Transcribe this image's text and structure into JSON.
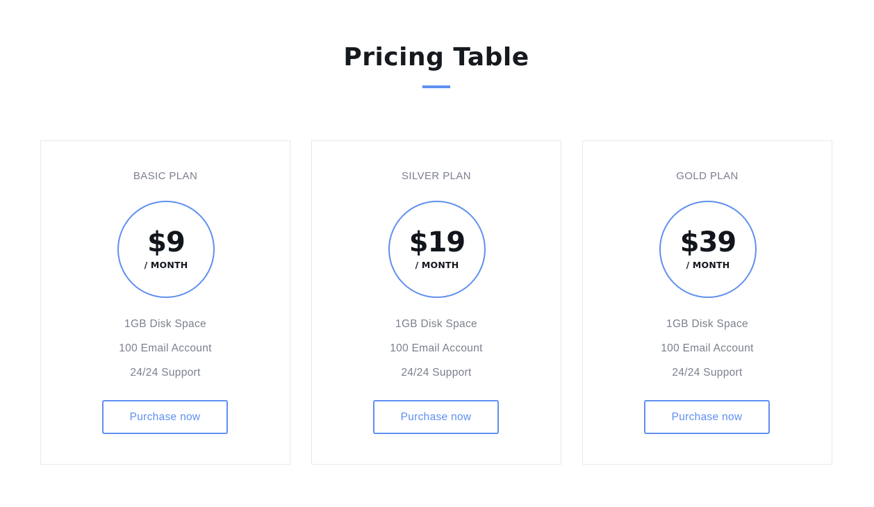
{
  "header": {
    "title": "Pricing Table"
  },
  "colors": {
    "accent": "#5f8ff0",
    "text_dark": "#12161c",
    "text_muted": "#7a808d",
    "card_border": "#e8e8ec"
  },
  "plans": [
    {
      "name": "BASIC PLAN",
      "price": "$9",
      "period": "/ MONTH",
      "features": [
        "1GB Disk Space",
        "100 Email Account",
        "24/24 Support"
      ],
      "button_label": "Purchase now"
    },
    {
      "name": "SILVER PLAN",
      "price": "$19",
      "period": "/ MONTH",
      "features": [
        "1GB Disk Space",
        "100 Email Account",
        "24/24 Support"
      ],
      "button_label": "Purchase now"
    },
    {
      "name": "GOLD PLAN",
      "price": "$39",
      "period": "/ MONTH",
      "features": [
        "1GB Disk Space",
        "100 Email Account",
        "24/24 Support"
      ],
      "button_label": "Purchase now"
    }
  ]
}
